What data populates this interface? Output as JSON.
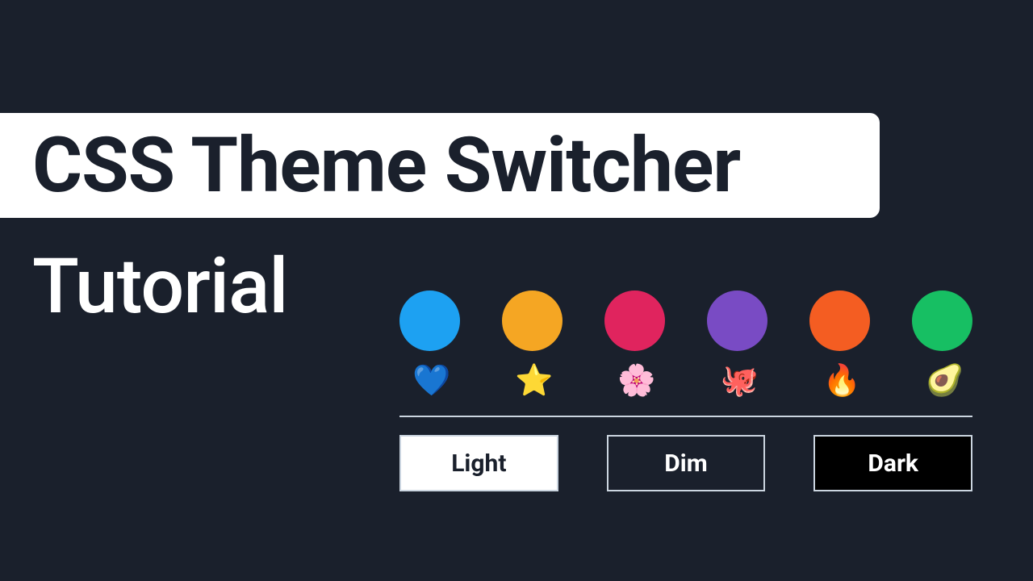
{
  "title": "CSS Theme Switcher",
  "subtitle": "Tutorial",
  "swatches": [
    {
      "name": "blue",
      "color": "#1da1f2",
      "emoji": "💙"
    },
    {
      "name": "yellow",
      "color": "#f5a623",
      "emoji": "⭐"
    },
    {
      "name": "pink",
      "color": "#e0245e",
      "emoji": "🌸"
    },
    {
      "name": "purple",
      "color": "#794bc4",
      "emoji": "🐙"
    },
    {
      "name": "orange",
      "color": "#f45d22",
      "emoji": "🔥"
    },
    {
      "name": "green",
      "color": "#17bf63",
      "emoji": "🥑"
    }
  ],
  "modes": {
    "light": "Light",
    "dim": "Dim",
    "dark": "Dark"
  }
}
